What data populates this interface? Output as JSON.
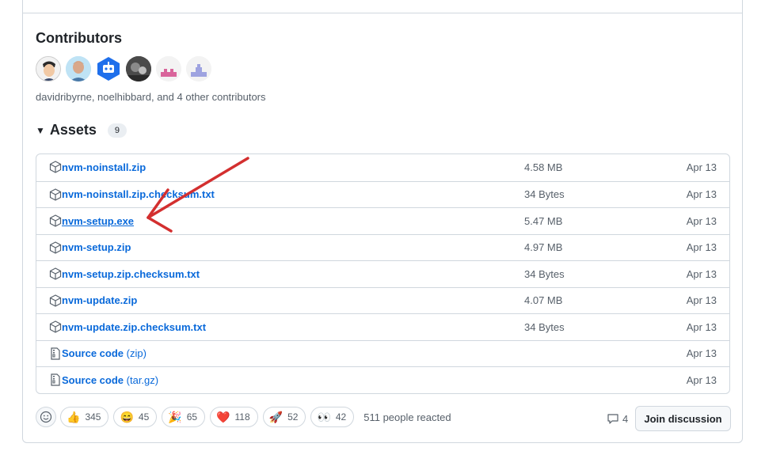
{
  "contributors": {
    "title": "Contributors",
    "summary": "davidribyrne, noelhibbard, and 4 other contributors"
  },
  "assets": {
    "title": "Assets",
    "count": "9",
    "items": [
      {
        "name": "nvm-noinstall.zip",
        "suffix": "",
        "size": "4.58 MB",
        "date": "Apr 13",
        "icon": "package-icon"
      },
      {
        "name": "nvm-noinstall.zip.checksum.txt",
        "suffix": "",
        "size": "34 Bytes",
        "date": "Apr 13",
        "icon": "package-icon"
      },
      {
        "name": "nvm-setup.exe",
        "suffix": "",
        "size": "5.47 MB",
        "date": "Apr 13",
        "icon": "package-icon"
      },
      {
        "name": "nvm-setup.zip",
        "suffix": "",
        "size": "4.97 MB",
        "date": "Apr 13",
        "icon": "package-icon"
      },
      {
        "name": "nvm-setup.zip.checksum.txt",
        "suffix": "",
        "size": "34 Bytes",
        "date": "Apr 13",
        "icon": "package-icon"
      },
      {
        "name": "nvm-update.zip",
        "suffix": "",
        "size": "4.07 MB",
        "date": "Apr 13",
        "icon": "package-icon"
      },
      {
        "name": "nvm-update.zip.checksum.txt",
        "suffix": "",
        "size": "34 Bytes",
        "date": "Apr 13",
        "icon": "package-icon"
      },
      {
        "name": "Source code",
        "suffix": " (zip)",
        "size": "",
        "date": "Apr 13",
        "icon": "file-zip-icon"
      },
      {
        "name": "Source code",
        "suffix": " (tar.gz)",
        "size": "",
        "date": "Apr 13",
        "icon": "file-zip-icon"
      }
    ]
  },
  "reactions": {
    "items": [
      {
        "emoji": "👍",
        "count": "345",
        "icon": "thumbs-up-icon"
      },
      {
        "emoji": "😄",
        "count": "45",
        "icon": "laugh-icon"
      },
      {
        "emoji": "🎉",
        "count": "65",
        "icon": "tada-icon"
      },
      {
        "emoji": "❤️",
        "count": "118",
        "icon": "heart-icon"
      },
      {
        "emoji": "🚀",
        "count": "52",
        "icon": "rocket-icon"
      },
      {
        "emoji": "👀",
        "count": "42",
        "icon": "eyes-icon"
      }
    ],
    "summary": "511 people reacted"
  },
  "footer": {
    "comment_count": "4",
    "join_label": "Join discussion"
  },
  "colors": {
    "link": "#0969da",
    "arrow": "#d32f2f"
  }
}
